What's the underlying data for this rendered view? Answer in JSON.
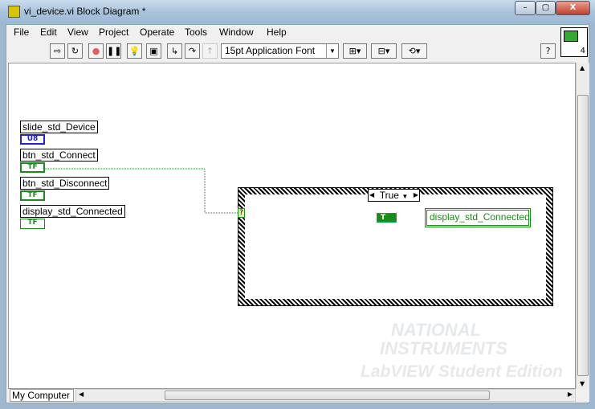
{
  "window": {
    "title": "vi_device.vi Block Diagram *",
    "minimize": "–",
    "maximize": "▢",
    "close": "X"
  },
  "menu": [
    "File",
    "Edit",
    "View",
    "Project",
    "Operate",
    "Tools",
    "Window",
    "Help"
  ],
  "toolbar": {
    "font": "15pt Application Font",
    "help": "?",
    "icon_pane_number": "4"
  },
  "terminals": [
    {
      "label": "slide_std_Device",
      "type": "U8",
      "color": "#2323c8"
    },
    {
      "label": "btn_std_Connect",
      "type": "TF",
      "color": "#1a8c1a"
    },
    {
      "label": "btn_std_Disconnect",
      "type": "TF",
      "color": "#1a8c1a"
    },
    {
      "label": "display_std_Connected",
      "type": "TF",
      "color": "#1a8c1a"
    }
  ],
  "case_structure": {
    "selector": "True",
    "terminal": "?",
    "constant": "T",
    "indicator": "display_std_Connected"
  },
  "status": {
    "context": "My Computer"
  },
  "watermark": {
    "line1": "NATIONAL",
    "line2": "INSTRUMENTS",
    "line3": "LabVIEW Student Edition"
  }
}
